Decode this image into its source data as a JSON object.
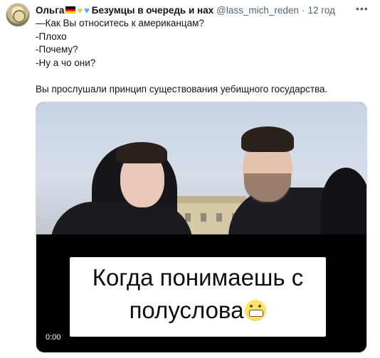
{
  "tweet": {
    "author_name": "Ольга",
    "author_name_suffix": "Безумцы в очередь и нах",
    "handle": "@lass_mich_reden",
    "separator": "·",
    "time": "12 год",
    "more_icon": "•••",
    "emoji": [
      "german-flag",
      "yellow-heart",
      "blue-heart"
    ],
    "lines": [
      "—Как Вы относитесь к американцам?",
      "-Плохо",
      "-Почему?",
      "-Ну а чо они?"
    ],
    "conclusion": "Вы прослушали принцип существования уебищного государства."
  },
  "video": {
    "caption_line1": "Когда понимаешь с",
    "caption_line2": "полуслова",
    "caption_emoji": "grinning-face",
    "timestamp": "0:00"
  }
}
